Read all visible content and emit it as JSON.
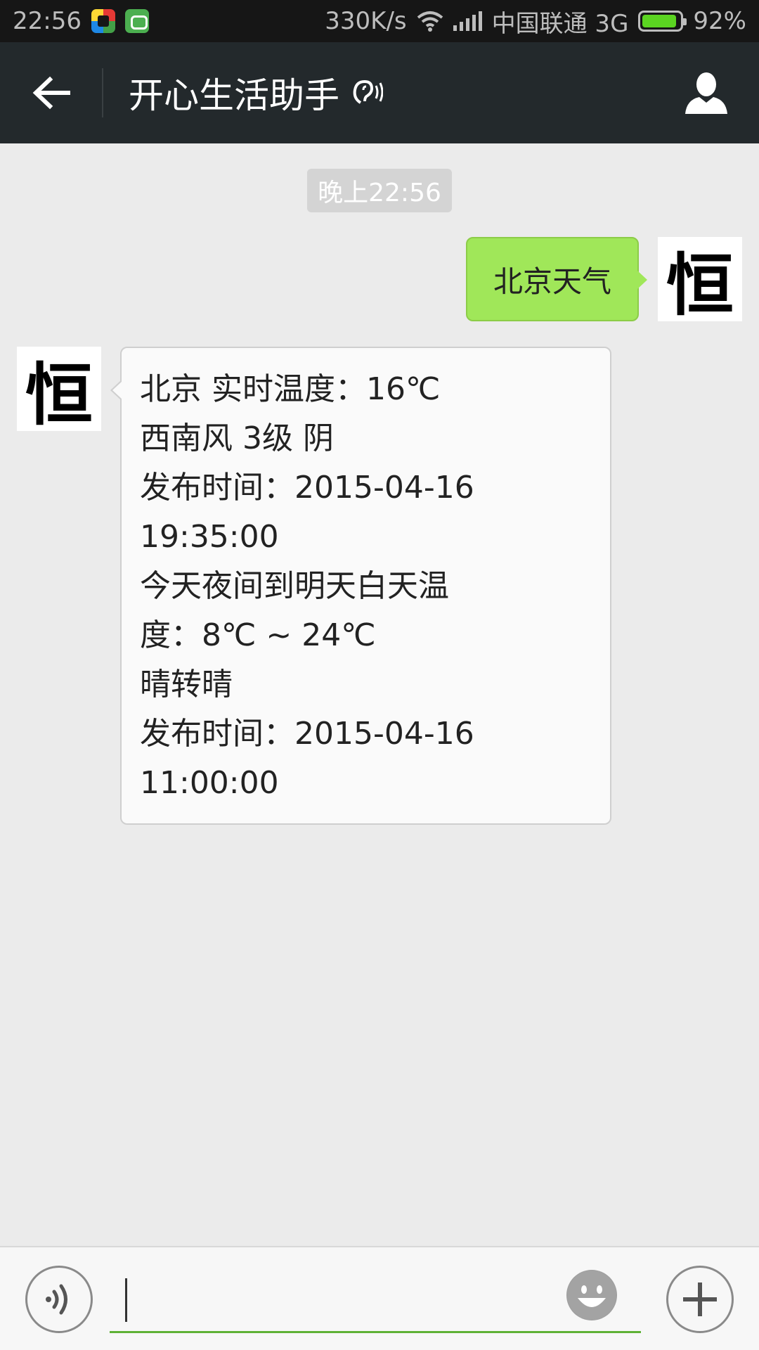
{
  "status_bar": {
    "time": "22:56",
    "speed": "330K/s",
    "carrier": "中国联通 3G",
    "battery": "92%",
    "battery_level": 0.92
  },
  "header": {
    "title": "开心生活助手",
    "back_icon": "arrow-left-icon",
    "earpiece_icon": "earpiece-icon",
    "profile_icon": "person-icon"
  },
  "chat": {
    "timestamp": "晚上22:56",
    "avatar_glyph": "恒",
    "sent_message": "北京天气",
    "reply_lines": [
      "北京 实时温度：16℃",
      "西南风 3级 阴",
      "发布时间：2015-04-16",
      "19:35:00",
      "今天夜间到明天白天温",
      "度：8℃ ~ 24℃",
      "晴转晴",
      "发布时间：2015-04-16",
      "11:00:00"
    ]
  },
  "input_bar": {
    "voice_icon": "voice-icon",
    "emoji_icon": "emoji-icon",
    "plus_icon": "plus-icon"
  },
  "colors": {
    "header_bg": "#23292c",
    "sent_bubble": "#a0e759",
    "input_underline": "#5fb236"
  }
}
